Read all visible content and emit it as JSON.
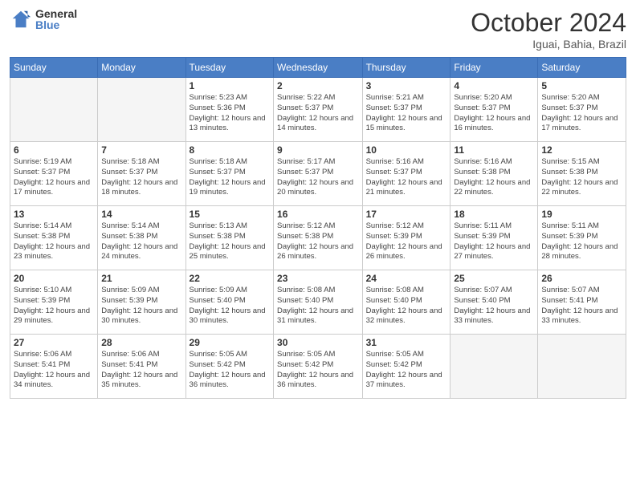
{
  "logo": {
    "general": "General",
    "blue": "Blue"
  },
  "title": "October 2024",
  "location": "Iguai, Bahia, Brazil",
  "days_header": [
    "Sunday",
    "Monday",
    "Tuesday",
    "Wednesday",
    "Thursday",
    "Friday",
    "Saturday"
  ],
  "weeks": [
    [
      {
        "day": "",
        "sunrise": "",
        "sunset": "",
        "daylight": ""
      },
      {
        "day": "",
        "sunrise": "",
        "sunset": "",
        "daylight": ""
      },
      {
        "day": "1",
        "sunrise": "Sunrise: 5:23 AM",
        "sunset": "Sunset: 5:36 PM",
        "daylight": "Daylight: 12 hours and 13 minutes."
      },
      {
        "day": "2",
        "sunrise": "Sunrise: 5:22 AM",
        "sunset": "Sunset: 5:37 PM",
        "daylight": "Daylight: 12 hours and 14 minutes."
      },
      {
        "day": "3",
        "sunrise": "Sunrise: 5:21 AM",
        "sunset": "Sunset: 5:37 PM",
        "daylight": "Daylight: 12 hours and 15 minutes."
      },
      {
        "day": "4",
        "sunrise": "Sunrise: 5:20 AM",
        "sunset": "Sunset: 5:37 PM",
        "daylight": "Daylight: 12 hours and 16 minutes."
      },
      {
        "day": "5",
        "sunrise": "Sunrise: 5:20 AM",
        "sunset": "Sunset: 5:37 PM",
        "daylight": "Daylight: 12 hours and 17 minutes."
      }
    ],
    [
      {
        "day": "6",
        "sunrise": "Sunrise: 5:19 AM",
        "sunset": "Sunset: 5:37 PM",
        "daylight": "Daylight: 12 hours and 17 minutes."
      },
      {
        "day": "7",
        "sunrise": "Sunrise: 5:18 AM",
        "sunset": "Sunset: 5:37 PM",
        "daylight": "Daylight: 12 hours and 18 minutes."
      },
      {
        "day": "8",
        "sunrise": "Sunrise: 5:18 AM",
        "sunset": "Sunset: 5:37 PM",
        "daylight": "Daylight: 12 hours and 19 minutes."
      },
      {
        "day": "9",
        "sunrise": "Sunrise: 5:17 AM",
        "sunset": "Sunset: 5:37 PM",
        "daylight": "Daylight: 12 hours and 20 minutes."
      },
      {
        "day": "10",
        "sunrise": "Sunrise: 5:16 AM",
        "sunset": "Sunset: 5:37 PM",
        "daylight": "Daylight: 12 hours and 21 minutes."
      },
      {
        "day": "11",
        "sunrise": "Sunrise: 5:16 AM",
        "sunset": "Sunset: 5:38 PM",
        "daylight": "Daylight: 12 hours and 22 minutes."
      },
      {
        "day": "12",
        "sunrise": "Sunrise: 5:15 AM",
        "sunset": "Sunset: 5:38 PM",
        "daylight": "Daylight: 12 hours and 22 minutes."
      }
    ],
    [
      {
        "day": "13",
        "sunrise": "Sunrise: 5:14 AM",
        "sunset": "Sunset: 5:38 PM",
        "daylight": "Daylight: 12 hours and 23 minutes."
      },
      {
        "day": "14",
        "sunrise": "Sunrise: 5:14 AM",
        "sunset": "Sunset: 5:38 PM",
        "daylight": "Daylight: 12 hours and 24 minutes."
      },
      {
        "day": "15",
        "sunrise": "Sunrise: 5:13 AM",
        "sunset": "Sunset: 5:38 PM",
        "daylight": "Daylight: 12 hours and 25 minutes."
      },
      {
        "day": "16",
        "sunrise": "Sunrise: 5:12 AM",
        "sunset": "Sunset: 5:38 PM",
        "daylight": "Daylight: 12 hours and 26 minutes."
      },
      {
        "day": "17",
        "sunrise": "Sunrise: 5:12 AM",
        "sunset": "Sunset: 5:39 PM",
        "daylight": "Daylight: 12 hours and 26 minutes."
      },
      {
        "day": "18",
        "sunrise": "Sunrise: 5:11 AM",
        "sunset": "Sunset: 5:39 PM",
        "daylight": "Daylight: 12 hours and 27 minutes."
      },
      {
        "day": "19",
        "sunrise": "Sunrise: 5:11 AM",
        "sunset": "Sunset: 5:39 PM",
        "daylight": "Daylight: 12 hours and 28 minutes."
      }
    ],
    [
      {
        "day": "20",
        "sunrise": "Sunrise: 5:10 AM",
        "sunset": "Sunset: 5:39 PM",
        "daylight": "Daylight: 12 hours and 29 minutes."
      },
      {
        "day": "21",
        "sunrise": "Sunrise: 5:09 AM",
        "sunset": "Sunset: 5:39 PM",
        "daylight": "Daylight: 12 hours and 30 minutes."
      },
      {
        "day": "22",
        "sunrise": "Sunrise: 5:09 AM",
        "sunset": "Sunset: 5:40 PM",
        "daylight": "Daylight: 12 hours and 30 minutes."
      },
      {
        "day": "23",
        "sunrise": "Sunrise: 5:08 AM",
        "sunset": "Sunset: 5:40 PM",
        "daylight": "Daylight: 12 hours and 31 minutes."
      },
      {
        "day": "24",
        "sunrise": "Sunrise: 5:08 AM",
        "sunset": "Sunset: 5:40 PM",
        "daylight": "Daylight: 12 hours and 32 minutes."
      },
      {
        "day": "25",
        "sunrise": "Sunrise: 5:07 AM",
        "sunset": "Sunset: 5:40 PM",
        "daylight": "Daylight: 12 hours and 33 minutes."
      },
      {
        "day": "26",
        "sunrise": "Sunrise: 5:07 AM",
        "sunset": "Sunset: 5:41 PM",
        "daylight": "Daylight: 12 hours and 33 minutes."
      }
    ],
    [
      {
        "day": "27",
        "sunrise": "Sunrise: 5:06 AM",
        "sunset": "Sunset: 5:41 PM",
        "daylight": "Daylight: 12 hours and 34 minutes."
      },
      {
        "day": "28",
        "sunrise": "Sunrise: 5:06 AM",
        "sunset": "Sunset: 5:41 PM",
        "daylight": "Daylight: 12 hours and 35 minutes."
      },
      {
        "day": "29",
        "sunrise": "Sunrise: 5:05 AM",
        "sunset": "Sunset: 5:42 PM",
        "daylight": "Daylight: 12 hours and 36 minutes."
      },
      {
        "day": "30",
        "sunrise": "Sunrise: 5:05 AM",
        "sunset": "Sunset: 5:42 PM",
        "daylight": "Daylight: 12 hours and 36 minutes."
      },
      {
        "day": "31",
        "sunrise": "Sunrise: 5:05 AM",
        "sunset": "Sunset: 5:42 PM",
        "daylight": "Daylight: 12 hours and 37 minutes."
      },
      {
        "day": "",
        "sunrise": "",
        "sunset": "",
        "daylight": ""
      },
      {
        "day": "",
        "sunrise": "",
        "sunset": "",
        "daylight": ""
      }
    ]
  ]
}
